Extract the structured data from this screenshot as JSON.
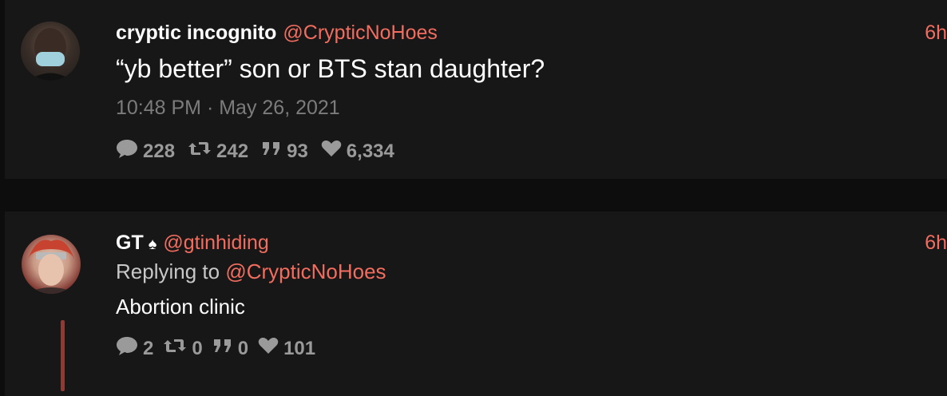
{
  "tweet": {
    "author_name": "cryptic incognito",
    "handle": "@CrypticNoHoes",
    "time_ago": "6h",
    "text": "“yb better” son or BTS stan daughter?",
    "timestamp": "10:48 PM · May 26, 2021",
    "stats": {
      "replies": "228",
      "retweets": "242",
      "quotes": "93",
      "likes": "6,334"
    }
  },
  "reply": {
    "author_name": "GT",
    "handle": "@gtinhiding",
    "time_ago": "6h",
    "replying_prefix": "Replying to",
    "replying_to": "@CrypticNoHoes",
    "text": "Abortion clinic",
    "stats": {
      "replies": "2",
      "retweets": "0",
      "quotes": "0",
      "likes": "101"
    }
  },
  "colors": {
    "background": "#0d0d0d",
    "card": "#171717",
    "accent": "#f26d5f",
    "muted": "#7c7c7c",
    "thread_line": "#8f3a35"
  },
  "icons": [
    "comment-icon",
    "retweet-icon",
    "quote-icon",
    "heart-icon",
    "spade-icon"
  ]
}
